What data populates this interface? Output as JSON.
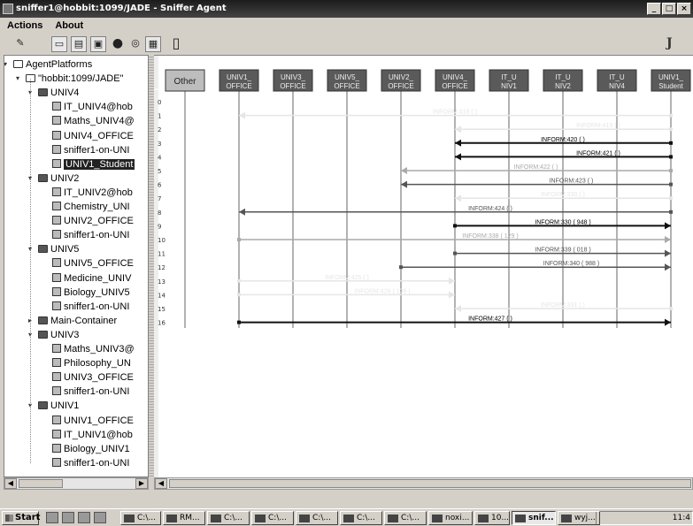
{
  "window": {
    "title": "sniffer1@hobbit:1099/JADE - Sniffer Agent"
  },
  "menu": [
    "Actions",
    "About"
  ],
  "toolbar": [
    "clear-icon",
    "open-icon",
    "save-as-icon",
    "save-icon",
    "record-icon",
    "filter-icon",
    "display-icon",
    "exit-door-icon"
  ],
  "tree": {
    "root": "AgentPlatforms",
    "platform": "\"hobbit:1099/JADE\"",
    "containers": [
      {
        "name": "UNIV4",
        "agents": [
          "IT_UNIV4@hob",
          "Maths_UNIV4@",
          "UNIV4_OFFICE",
          "sniffer1-on-UNI",
          "UNIV1_Student"
        ],
        "selected": 4
      },
      {
        "name": "UNIV2",
        "agents": [
          "IT_UNIV2@hob",
          "Chemistry_UNI",
          "UNIV2_OFFICE",
          "sniffer1-on-UNI"
        ]
      },
      {
        "name": "UNIV5",
        "agents": [
          "UNIV5_OFFICE",
          "Medicine_UNIV",
          "Biology_UNIV5",
          "sniffer1-on-UNI"
        ]
      },
      {
        "name": "Main-Container",
        "agents": [],
        "collapsed": true
      },
      {
        "name": "UNIV3",
        "agents": [
          "Maths_UNIV3@",
          "Philosophy_UN",
          "UNIV3_OFFICE",
          "sniffer1-on-UNI"
        ]
      },
      {
        "name": "UNIV1",
        "agents": [
          "UNIV1_OFFICE",
          "IT_UNIV1@hob",
          "Biology_UNIV1",
          "sniffer1-on-UNI"
        ]
      }
    ]
  },
  "diagram": {
    "columns": [
      {
        "lines": [
          "Other"
        ],
        "dark": false
      },
      {
        "lines": [
          "UNIV1_",
          "OFFICE"
        ],
        "dark": true
      },
      {
        "lines": [
          "UNIV3_",
          "OFFICE"
        ],
        "dark": true
      },
      {
        "lines": [
          "UNIV5_",
          "OFFICE"
        ],
        "dark": true
      },
      {
        "lines": [
          "UNIV2_",
          "OFFICE"
        ],
        "dark": true
      },
      {
        "lines": [
          "UNIV4_",
          "OFFICE"
        ],
        "dark": true
      },
      {
        "lines": [
          "IT_U",
          "NIV1"
        ],
        "dark": true
      },
      {
        "lines": [
          "IT_U",
          "NIV2"
        ],
        "dark": true
      },
      {
        "lines": [
          "IT_U",
          "NIV4"
        ],
        "dark": true
      },
      {
        "lines": [
          "UNIV1_",
          "Student"
        ],
        "dark": true
      }
    ],
    "row_numbers": [
      "0",
      "1",
      "2",
      "3",
      "4",
      "5",
      "6",
      "7",
      "8",
      "9",
      "10",
      "11",
      "12",
      "13",
      "14",
      "15",
      "16"
    ],
    "messages": [
      {
        "row": 1,
        "from": 9,
        "to": 1,
        "label": "INFORM:418 (  )",
        "tone": "faint"
      },
      {
        "row": 2,
        "from": 9,
        "to": 5,
        "label": "INFORM:419 (  )",
        "tone": "faint"
      },
      {
        "row": 3,
        "from": 9,
        "to": 5,
        "label": "INFORM:420 (    )",
        "tone": "dark"
      },
      {
        "row": 4,
        "from": 9,
        "to": 5,
        "label": "INFORM:421 (    )",
        "tone": "dark"
      },
      {
        "row": 5,
        "from": 9,
        "to": 4,
        "label": "INFORM:422 (  )",
        "tone": "light"
      },
      {
        "row": 6,
        "from": 9,
        "to": 4,
        "label": "INFORM:423 (  )",
        "tone": "mid"
      },
      {
        "row": 7,
        "from": 9,
        "to": 5,
        "label": "INFORM:330 (  )",
        "tone": "faint"
      },
      {
        "row": 8,
        "from": 9,
        "to": 1,
        "label": "INFORM:424 (    )",
        "tone": "mid"
      },
      {
        "row": 9,
        "from": 5,
        "to": 9,
        "label": "INFORM:330 (  948  )",
        "tone": "dark"
      },
      {
        "row": 10,
        "from": 1,
        "to": 9,
        "label": "INFORM:338 (  129  )",
        "tone": "light"
      },
      {
        "row": 11,
        "from": 5,
        "to": 9,
        "label": "INFORM:339 (  018  )",
        "tone": "mid"
      },
      {
        "row": 12,
        "from": 4,
        "to": 9,
        "label": "INFORM:340 (  988  )",
        "tone": "mid"
      },
      {
        "row": 13,
        "from": 1,
        "to": 5,
        "label": "INFORM:425 (  )",
        "tone": "faint"
      },
      {
        "row": 14,
        "from": 1,
        "to": 5,
        "label": "INFORM:426 (  109  )",
        "tone": "faint"
      },
      {
        "row": 15,
        "from": 9,
        "to": 5,
        "label": "INFORM:331 (  )",
        "tone": "faint"
      },
      {
        "row": 16,
        "from": 1,
        "to": 9,
        "label": "INFORM:427 (    )",
        "tone": "dark"
      }
    ]
  },
  "taskbar": {
    "start": "Start",
    "tasks": [
      {
        "label": "C:\\..."
      },
      {
        "label": "RM..."
      },
      {
        "label": "C:\\..."
      },
      {
        "label": "C:\\..."
      },
      {
        "label": "C:\\..."
      },
      {
        "label": "C:\\..."
      },
      {
        "label": "C:\\..."
      },
      {
        "label": "noxi..."
      },
      {
        "label": "10..."
      },
      {
        "label": "snif...",
        "active": true
      },
      {
        "label": "wyj..."
      }
    ],
    "clock": "11:4"
  }
}
